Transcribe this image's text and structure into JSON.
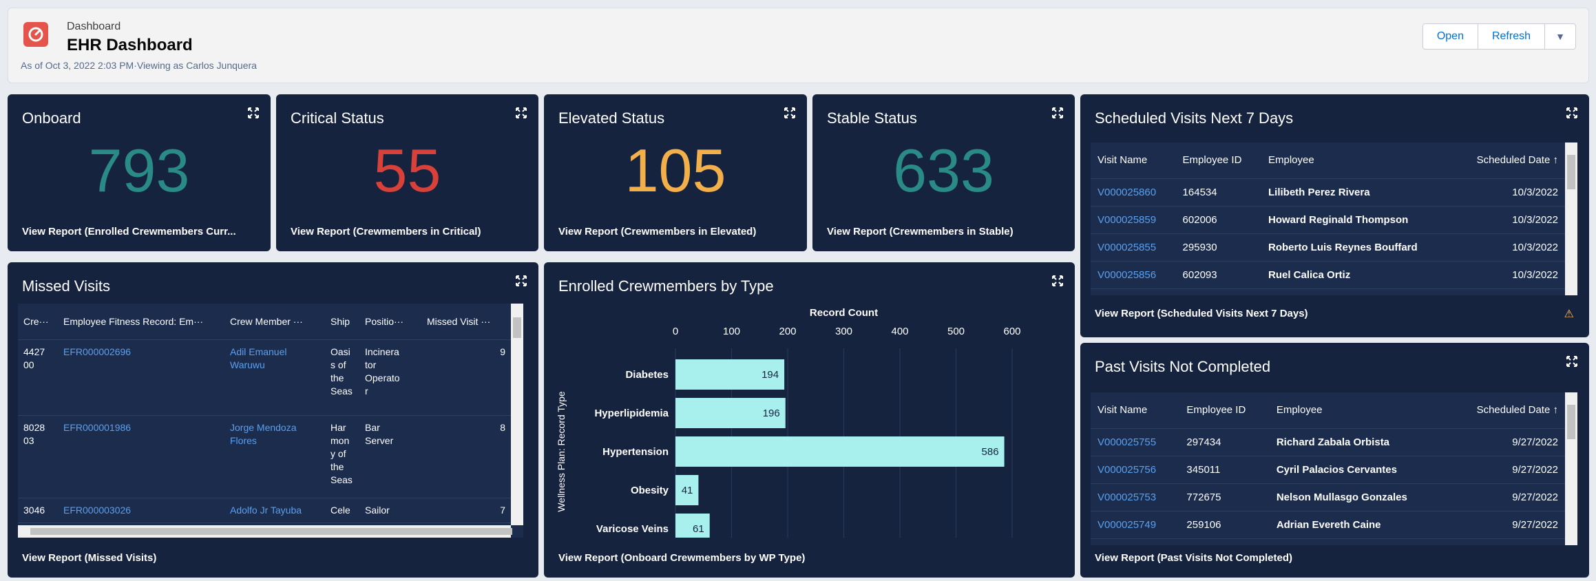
{
  "header": {
    "subtitle": "Dashboard",
    "title": "EHR Dashboard",
    "meta": "As of Oct 3, 2022 2:03 PM·Viewing as Carlos Junquera",
    "open_label": "Open",
    "refresh_label": "Refresh",
    "icon": "dashboard-gauge-icon"
  },
  "metrics": [
    {
      "title": "Onboard",
      "value": "793",
      "color": "#2a8a86",
      "link": "View Report (Enrolled Crewmembers Curr..."
    },
    {
      "title": "Critical Status",
      "value": "55",
      "color": "#d8403a",
      "link": "View Report (Crewmembers in Critical)"
    },
    {
      "title": "Elevated Status",
      "value": "105",
      "color": "#f3b04a",
      "link": "View Report (Crewmembers in Elevated)"
    },
    {
      "title": "Stable Status",
      "value": "633",
      "color": "#2a8a86",
      "link": "View Report (Crewmembers in Stable)"
    }
  ],
  "scheduled": {
    "title": "Scheduled Visits Next 7 Days",
    "columns": [
      "Visit Name",
      "Employee ID",
      "Employee",
      "Scheduled Date ↑"
    ],
    "rows": [
      [
        "V000025860",
        "164534",
        "Lilibeth Perez Rivera",
        "10/3/2022"
      ],
      [
        "V000025859",
        "602006",
        "Howard Reginald Thompson",
        "10/3/2022"
      ],
      [
        "V000025855",
        "295930",
        "Roberto Luis Reynes Bouffard",
        "10/3/2022"
      ],
      [
        "V000025856",
        "602093",
        "Ruel Calica Ortiz",
        "10/3/2022"
      ]
    ],
    "link": "View Report (Scheduled Visits Next 7 Days)",
    "warning_icon": "warning-icon",
    "warning_glyph": "⚠"
  },
  "missed": {
    "title": "Missed Visits",
    "columns": [
      "Cre···",
      "Employee Fitness Record: Em···",
      "Crew Member ···",
      "Ship",
      "Positio···",
      "Missed Visit ···"
    ],
    "rows": [
      [
        "4427\n00",
        "EFR000002696",
        "Adil Emanuel\nWaruwu",
        "Oasi\ns of\nthe\nSeas",
        "Incinera\ntor\nOperato\nr",
        "9"
      ],
      [
        "8028\n03",
        "EFR000001986",
        "Jorge Mendoza\nFlores",
        "Har\nmon\ny of\nthe\nSeas",
        "Bar\nServer",
        "8"
      ],
      [
        "3046",
        "EFR000003026",
        "Adolfo Jr Tayuba",
        "Cele",
        "Sailor",
        "7"
      ]
    ],
    "link": "View Report (Missed Visits)"
  },
  "enrolled": {
    "title": "Enrolled Crewmembers by Type",
    "link": "View Report (Onboard Crewmembers by WP Type)"
  },
  "past": {
    "title": "Past Visits Not Completed",
    "columns": [
      "Visit Name",
      "Employee ID",
      "Employee",
      "Scheduled Date ↑"
    ],
    "rows": [
      [
        "V000025755",
        "297434",
        "Richard Zabala Orbista",
        "9/27/2022"
      ],
      [
        "V000025756",
        "345011",
        "Cyril Palacios Cervantes",
        "9/27/2022"
      ],
      [
        "V000025753",
        "772675",
        "Nelson Mullasgo Gonzales",
        "9/27/2022"
      ],
      [
        "V000025749",
        "259106",
        "Adrian Evereth Caine",
        "9/27/2022"
      ]
    ],
    "link": "View Report (Past Visits Not Completed)"
  },
  "chart_data": {
    "type": "bar",
    "orientation": "horizontal",
    "title": "Record Count",
    "xlabel": "Record Count",
    "ylabel": "Wellness Plan: Record Type",
    "categories": [
      "Diabetes",
      "Hyperlipidemia",
      "Hypertension",
      "Obesity",
      "Varicose Veins"
    ],
    "values": [
      194,
      196,
      586,
      41,
      61
    ],
    "xlim": [
      0,
      600
    ],
    "xticks": [
      0,
      100,
      200,
      300,
      400,
      500,
      600
    ],
    "bar_color": "#a8f0ee",
    "grid": true
  }
}
